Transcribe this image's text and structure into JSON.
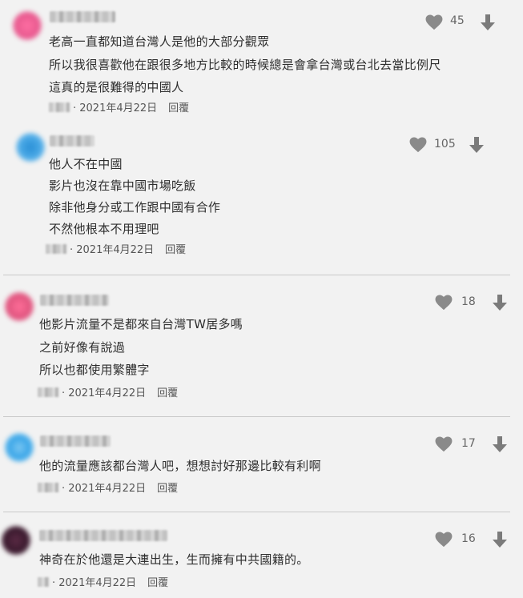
{
  "comments": [
    {
      "lines": [
        "老高一直都知道台灣人是他的大部分觀眾",
        "所以我很喜歡他在跟很多地方比較的時候總是會拿台灣或台北去當比例尺",
        "這真的是很難得的中國人"
      ],
      "likes": "45",
      "date": "· 2021年4月22日",
      "reply": "回覆",
      "avatar_color": "#e85a8f"
    },
    {
      "lines": [
        "他人不在中國",
        "影片也沒在靠中國市場吃飯",
        "除非他身分或工作跟中國有合作",
        "不然他根本不用理吧"
      ],
      "likes": "105",
      "date": "· 2021年4月22日",
      "reply": "回覆",
      "avatar_color": "#2a8fd6"
    },
    {
      "lines": [
        "他影片流量不是都來自台灣TW居多嗎",
        "之前好像有說過",
        "所以也都使用繁體字"
      ],
      "likes": "18",
      "date": "· 2021年4月22日",
      "reply": "回覆",
      "avatar_color": "#e0557f"
    },
    {
      "lines": [
        "他的流量應該都台灣人吧，想想討好那邊比較有利啊"
      ],
      "likes": "17",
      "date": "· 2021年4月22日",
      "reply": "回覆",
      "avatar_color": "#3aa6e8"
    },
    {
      "lines": [
        "神奇在於他還是大連出生，生而擁有中共國籍的。"
      ],
      "likes": "16",
      "date": "· 2021年4月22日",
      "reply": "回覆",
      "avatar_color": "#3a1a2e"
    }
  ]
}
